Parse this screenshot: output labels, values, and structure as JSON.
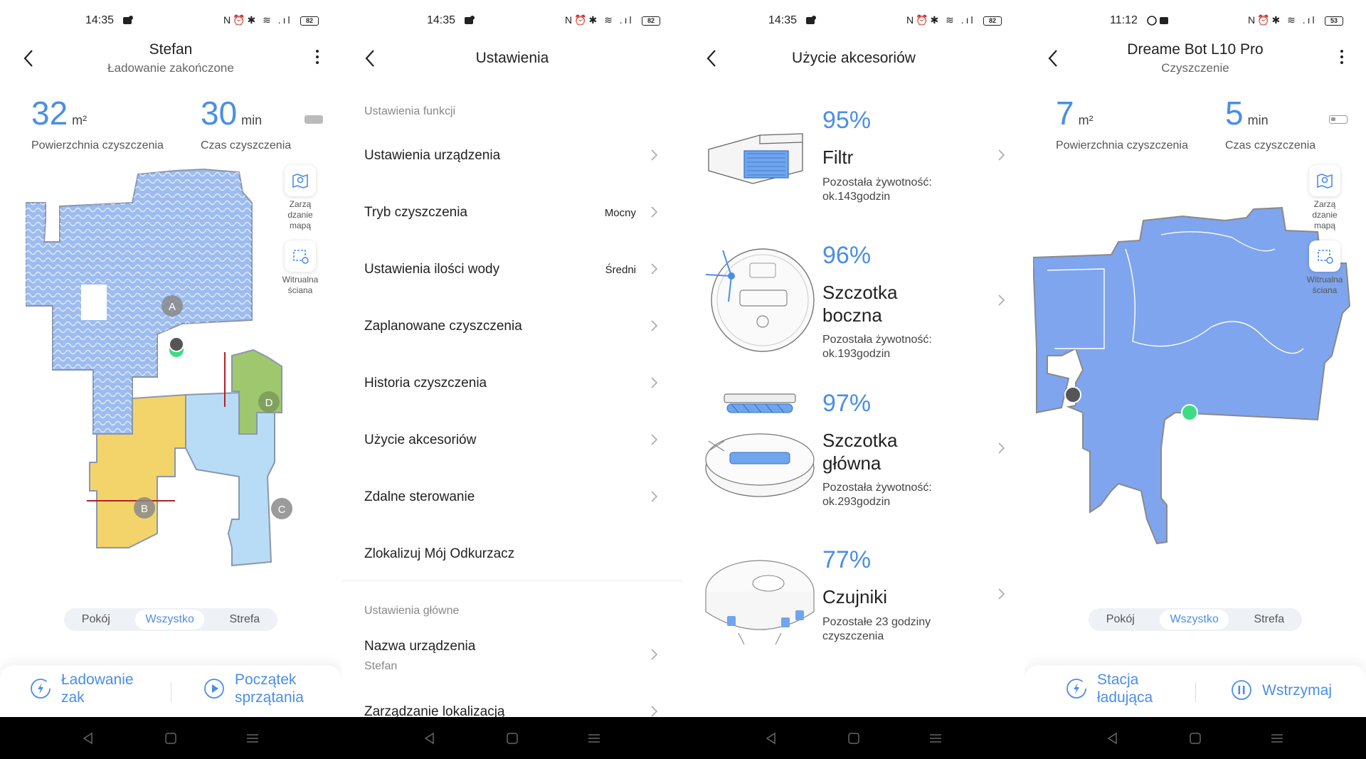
{
  "screen1": {
    "status": {
      "time": "14:35",
      "icons": "N⏰✱ ≋ .ıl",
      "battery": "82"
    },
    "title": "Stefan",
    "subtitle": "Ładowanie zakończone",
    "area_value": "32",
    "area_unit": "m²",
    "area_label": "Powierzchnia czyszczenia",
    "time_value": "30",
    "time_unit": "min",
    "time_label": "Czas czyszczenia",
    "tool_map": "Zarzą dzanie mapą",
    "tool_wall": "Witrualna ściana",
    "rooms": {
      "a": "A",
      "b": "B",
      "c": "C",
      "d": "D"
    },
    "segments": [
      "Pokój",
      "Wszystko",
      "Strefa"
    ],
    "action_left": "Ładowanie zak",
    "action_right": "Początek sprzątania"
  },
  "screen2": {
    "status": {
      "time": "14:35",
      "icons": "N⏰✱ ≋ .ıl",
      "battery": "82"
    },
    "title": "Ustawienia",
    "section1": "Ustawienia funkcji",
    "rows": [
      {
        "label": "Ustawienia urządzenia",
        "value": ""
      },
      {
        "label": "Tryb czyszczenia",
        "value": "Mocny"
      },
      {
        "label": "Ustawienia ilości wody",
        "value": "Średni"
      },
      {
        "label": "Zaplanowane czyszczenia",
        "value": ""
      },
      {
        "label": "Historia czyszczenia",
        "value": ""
      },
      {
        "label": "Użycie akcesoriów",
        "value": ""
      },
      {
        "label": "Zdalne sterowanie",
        "value": ""
      },
      {
        "label": "Zlokalizuj Mój Odkurzacz",
        "value": ""
      }
    ],
    "section2": "Ustawienia główne",
    "name_row": {
      "label": "Nazwa urządzenia",
      "sub": "Stefan"
    },
    "loc_row": "Zarządzanie lokalizacją"
  },
  "screen3": {
    "status": {
      "time": "14:35",
      "icons": "N⏰✱ ≋ .ıl",
      "battery": "82"
    },
    "title": "Użycie akcesoriów",
    "items": [
      {
        "percent": "95%",
        "name": "Filtr",
        "life": "Pozostała żywotność: ok.143godzin"
      },
      {
        "percent": "96%",
        "name": "Szczotka boczna",
        "life": "Pozostała żywotność: ok.193godzin"
      },
      {
        "percent": "97%",
        "name": "Szczotka główna",
        "life": "Pozostała żywotność: ok.293godzin"
      },
      {
        "percent": "77%",
        "name": "Czujniki",
        "life": "Pozostałe 23 godziny czyszczenia"
      }
    ]
  },
  "screen4": {
    "status": {
      "time": "11:12",
      "icons": "N⏰✱ ≋ .ıl",
      "battery": "53"
    },
    "title": "Dreame Bot L10 Pro",
    "subtitle": "Czyszczenie",
    "area_value": "7",
    "area_unit": "m²",
    "area_label": "Powierzchnia czyszczenia",
    "time_value": "5",
    "time_unit": "min",
    "time_label": "Czas czyszczenia",
    "tool_map": "Zarzą dzanie mapą",
    "tool_wall": "Witrualna ściana",
    "segments": [
      "Pokój",
      "Wszystko",
      "Strefa"
    ],
    "action_left": "Stacja ładująca",
    "action_right": "Wstrzymaj"
  },
  "colors": {
    "accent": "#4a8ee8",
    "map_blue": "#9dbcf0",
    "room_yellow": "#f3d46a",
    "room_green": "#9fc86e",
    "room_lightblue": "#b8dcf6"
  }
}
